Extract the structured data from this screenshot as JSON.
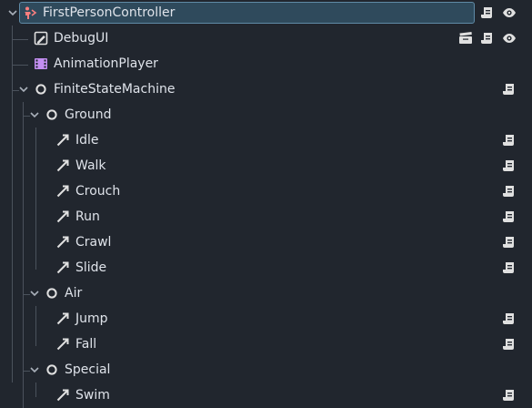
{
  "nodes": [
    {
      "label": "FirstPersonController",
      "icon": "character-body-icon",
      "selected": true,
      "expanded": true,
      "actions": [
        "script-icon",
        "visibility-eye-icon"
      ]
    },
    {
      "label": "DebugUI",
      "icon": "control-node-icon",
      "actions": [
        "scene-instance-icon",
        "script-icon",
        "visibility-eye-icon"
      ]
    },
    {
      "label": "AnimationPlayer",
      "icon": "animation-player-icon",
      "actions": []
    },
    {
      "label": "FiniteStateMachine",
      "icon": "node-circle-icon",
      "expanded": true,
      "actions": [
        "script-icon"
      ]
    },
    {
      "label": "Ground",
      "icon": "node-circle-icon",
      "expanded": true,
      "actions": []
    },
    {
      "label": "Idle",
      "icon": "state-arrow-icon",
      "actions": [
        "script-icon"
      ]
    },
    {
      "label": "Walk",
      "icon": "state-arrow-icon",
      "actions": [
        "script-icon"
      ]
    },
    {
      "label": "Crouch",
      "icon": "state-arrow-icon",
      "actions": [
        "script-icon"
      ]
    },
    {
      "label": "Run",
      "icon": "state-arrow-icon",
      "actions": [
        "script-icon"
      ]
    },
    {
      "label": "Crawl",
      "icon": "state-arrow-icon",
      "actions": [
        "script-icon"
      ]
    },
    {
      "label": "Slide",
      "icon": "state-arrow-icon",
      "actions": [
        "script-icon"
      ]
    },
    {
      "label": "Air",
      "icon": "node-circle-icon",
      "expanded": true,
      "actions": []
    },
    {
      "label": "Jump",
      "icon": "state-arrow-icon",
      "actions": [
        "script-icon"
      ]
    },
    {
      "label": "Fall",
      "icon": "state-arrow-icon",
      "actions": [
        "script-icon"
      ]
    },
    {
      "label": "Special",
      "icon": "node-circle-icon",
      "expanded": true,
      "actions": []
    },
    {
      "label": "Swim",
      "icon": "state-arrow-icon",
      "actions": [
        "script-icon"
      ]
    }
  ],
  "colors": {
    "background": "#21262e",
    "text": "#dfe3ea",
    "selection": "#2f4a5c",
    "selection_border": "#5f8aa6",
    "guide": "#4b525c",
    "icon_light": "#e0e0e0",
    "character_icon": "#fc7f7f",
    "animation_icon": "#c38ef1"
  }
}
